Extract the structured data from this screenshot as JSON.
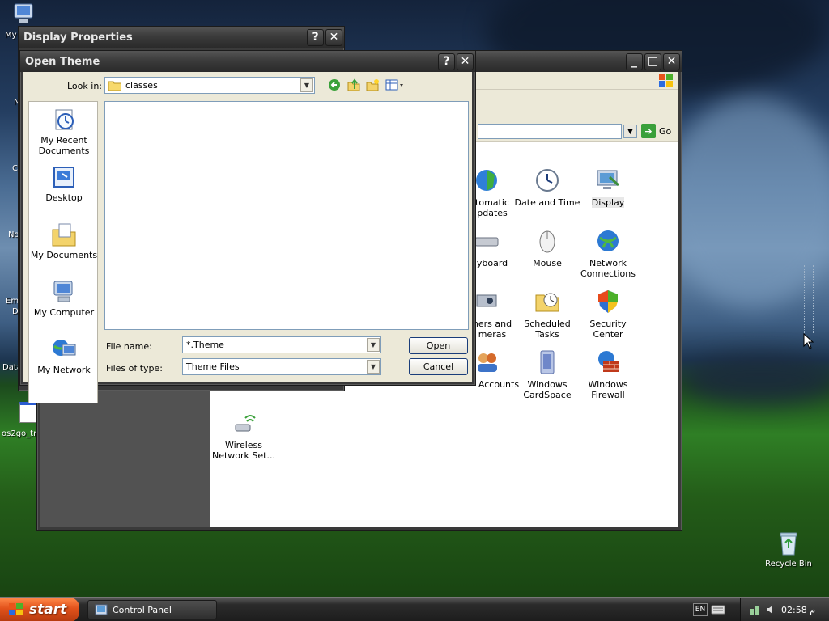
{
  "desktop": {
    "icons": [
      {
        "id": "my-computer",
        "label": "My"
      },
      {
        "id": "clip-n",
        "label": "N"
      },
      {
        "id": "clip-c",
        "label": "C"
      },
      {
        "id": "clip-no",
        "label": "No"
      },
      {
        "id": "clip-em",
        "label": "Em"
      },
      {
        "id": "clip-d",
        "label": "D"
      },
      {
        "id": "clip-data",
        "label": "Data"
      },
      {
        "id": "os2go",
        "label": "os2go_tr"
      },
      {
        "id": "recycle-bin",
        "label": "Recycle Bin"
      }
    ]
  },
  "control_panel": {
    "go_label": "Go",
    "items": [
      {
        "label": "Automatic Updates",
        "visible": "tomatic\npdates",
        "icon": "globe-shield-icon"
      },
      {
        "label": "Date and Time",
        "icon": "clock-icon"
      },
      {
        "label": "Display",
        "icon": "display-icon",
        "selected": true
      },
      {
        "label": "Keyboard",
        "visible": "yboard",
        "icon": "keyboard-icon"
      },
      {
        "label": "Mouse",
        "icon": "mouse-icon"
      },
      {
        "label": "Network Connections",
        "icon": "network-globe-icon"
      },
      {
        "label": "Scanners and Cameras",
        "visible": "ners and\nmeras",
        "icon": "scanner-icon"
      },
      {
        "label": "Scheduled Tasks",
        "icon": "scheduled-folder-icon"
      },
      {
        "label": "Security Center",
        "icon": "security-shield-icon"
      },
      {
        "label": "User Accounts",
        "visible": "Accounts",
        "icon": "users-icon"
      },
      {
        "label": "Windows CardSpace",
        "icon": "cardspace-icon"
      },
      {
        "label": "Windows Firewall",
        "icon": "firewall-icon"
      },
      {
        "label": "Wireless Network Set...",
        "icon": "wireless-icon"
      }
    ]
  },
  "display_properties": {
    "title": "Display Properties"
  },
  "open_theme": {
    "title": "Open Theme",
    "look_in_label": "Look in:",
    "look_in_value": "classes",
    "places": [
      {
        "label": "My Recent Documents",
        "icon": "recent-documents-icon"
      },
      {
        "label": "Desktop",
        "icon": "desktop-icon"
      },
      {
        "label": "My Documents",
        "icon": "my-documents-icon"
      },
      {
        "label": "My Computer",
        "icon": "my-computer-icon"
      },
      {
        "label": "My Network",
        "icon": "my-network-icon"
      }
    ],
    "file_name_label": "File name:",
    "file_name_value": "*.Theme",
    "files_of_type_label": "Files of type:",
    "files_of_type_value": "Theme Files",
    "open_button": "Open",
    "cancel_button": "Cancel"
  },
  "taskbar": {
    "start_label": "start",
    "tasks": [
      {
        "label": "Control Panel"
      }
    ],
    "language": "EN",
    "clock": "02:58 م"
  }
}
